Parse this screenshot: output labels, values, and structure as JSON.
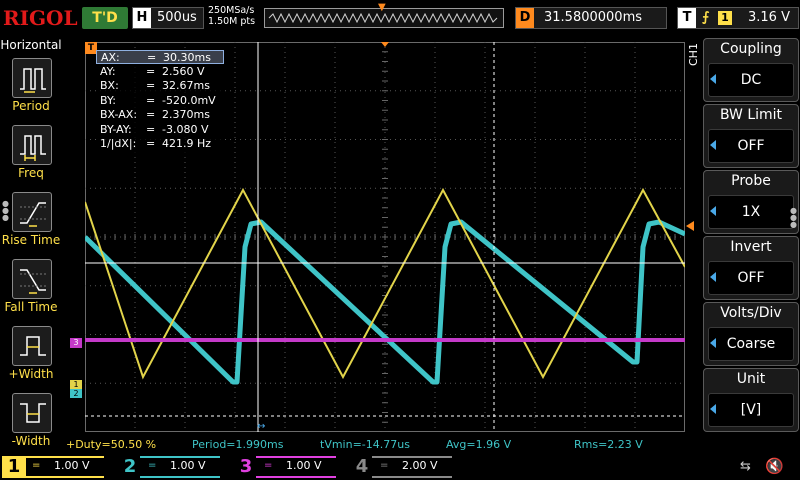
{
  "header": {
    "logo": "RIGOL",
    "run_state": "T'D",
    "horizontal_label": "H",
    "timebase": "500us",
    "sample_rate": "250MSa/s",
    "memory_depth": "1.50M pts",
    "delay_label": "D",
    "delay": "31.5800000ms",
    "trigger_label": "T",
    "trigger_edge": "⨍",
    "trigger_channel": "1",
    "trigger_level": "3.16 V"
  },
  "left_menu": {
    "title": "Horizontal",
    "items": [
      {
        "label": "Period",
        "icon": "period-icon"
      },
      {
        "label": "Freq",
        "icon": "freq-icon"
      },
      {
        "label": "Rise Time",
        "icon": "rise-time-icon"
      },
      {
        "label": "Fall Time",
        "icon": "fall-time-icon"
      },
      {
        "label": "+Width",
        "icon": "pos-width-icon"
      },
      {
        "label": "-Width",
        "icon": "neg-width-icon"
      }
    ]
  },
  "cursor_table": {
    "rows": [
      {
        "key": "AX:",
        "eq": "=",
        "value": "30.30ms"
      },
      {
        "key": "AY:",
        "eq": "=",
        "value": "2.560 V"
      },
      {
        "key": "BX:",
        "eq": "=",
        "value": "32.67ms"
      },
      {
        "key": "BY:",
        "eq": "=",
        "value": "-520.0mV"
      },
      {
        "key": "BX-AX:",
        "eq": "=",
        "value": "2.370ms"
      },
      {
        "key": "BY-AY:",
        "eq": "=",
        "value": "-3.080 V"
      },
      {
        "key": "1/|dX|:",
        "eq": "=",
        "value": "421.9 Hz"
      }
    ]
  },
  "measurements": {
    "duty": "+Duty=50.50 %",
    "period": "Period=1.990ms",
    "tvmin": "tVmin=-14.77us",
    "avg": "Avg=1.96 V",
    "rms": "Rms=2.23 V"
  },
  "marker_labels": {
    "trigger_marker": "T",
    "ch3_marker": "3",
    "ch1_marker": "1",
    "ch2_marker": "2"
  },
  "right_menu": {
    "channel_tag": "CH1",
    "items": [
      {
        "title": "Coupling",
        "value": "DC"
      },
      {
        "title": "BW Limit",
        "value": "OFF"
      },
      {
        "title": "Probe",
        "value": "1X"
      },
      {
        "title": "Invert",
        "value": "OFF"
      },
      {
        "title": "Volts/Div",
        "value": "Coarse"
      },
      {
        "title": "Unit",
        "value": "[V]"
      }
    ]
  },
  "channels": [
    {
      "num": "1",
      "coupling": "=",
      "scale": "1.00 V",
      "color": "#ffe04a",
      "active": true
    },
    {
      "num": "2",
      "coupling": "=",
      "scale": "1.00 V",
      "color": "#3fc4c7",
      "active": true
    },
    {
      "num": "3",
      "coupling": "=",
      "scale": "1.00 V",
      "color": "#e040e0",
      "active": true
    },
    {
      "num": "4",
      "coupling": "=",
      "scale": "2.00 V",
      "color": "#8a8a8a",
      "active": false
    }
  ],
  "colors": {
    "ch1": "#e2d44a",
    "ch2": "#3fc4c7",
    "ch3": "#c43ac9",
    "trigger": "#ff8a1e",
    "accent": "#4aa9e8"
  }
}
